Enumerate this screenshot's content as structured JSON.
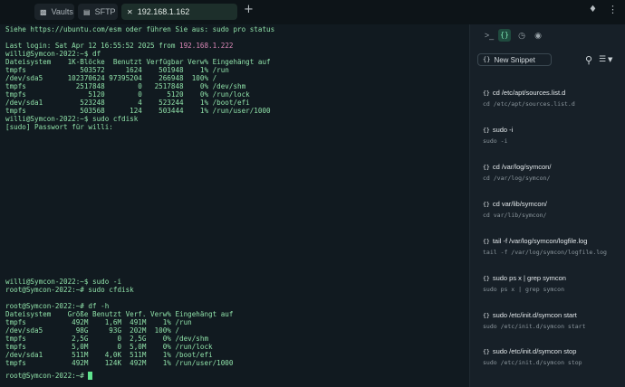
{
  "window": {
    "tabs": [
      {
        "label": "Vaults",
        "icon": "vault-icon"
      },
      {
        "label": "SFTP",
        "icon": "folder-icon"
      },
      {
        "label": "192.168.1.162",
        "icon": "close-icon",
        "active": true
      }
    ],
    "new_tab": "+"
  },
  "terminal": {
    "lines": [
      "Siehe https://ubuntu.com/esm oder führen Sie aus: sudo pro status",
      "",
      "Last login: Sat Apr 12 16:55:52 2025 from ",
      "willi@Symcon-2022:~$ df",
      "Dateisystem    1K-Blöcke  Benutzt Verfügbar Verw% Eingehängt auf",
      "tmpfs             503572     1624    501948    1% /run",
      "/dev/sda5      102370624 97395204    266948  100% /",
      "tmpfs            2517848        0   2517848    0% /dev/shm",
      "tmpfs               5120        0      5120    0% /run/lock",
      "/dev/sda1         523248        4    523244    1% /boot/efi",
      "tmpfs             503568      124    503444    1% /run/user/1000",
      "willi@Symcon-2022:~$ sudo cfdisk",
      "[sudo] Passwort für willi:",
      "willi@Symcon-2022:~$ sudo -i",
      "root@Symcon-2022:~# sudo cfdisk",
      "",
      "root@Symcon-2022:~# df -h",
      "Dateisystem    Größe Benutzt Verf. Verw% Eingehängt auf",
      "tmpfs           492M    1,6M  491M    1% /run",
      "/dev/sda5        98G     93G  202M  100% /",
      "tmpfs           2,5G       0  2,5G    0% /dev/shm",
      "tmpfs           5,0M       0  5,0M    0% /run/lock",
      "/dev/sda1       511M    4,0K  511M    1% /boot/efi",
      "tmpfs           492M    124K  492M    1% /run/user/1000",
      "root@Symcon-2022:~# "
    ],
    "highlight_ip": "192.168.1.222",
    "text_color": "#8fe0a8",
    "highlight_color": "#d987b6"
  },
  "panel": {
    "icons": [
      "terminal-icon",
      "snippets-icon",
      "history-icon",
      "palette-icon"
    ],
    "new_snippet_label": "New Snippet",
    "snippets": [
      {
        "name": "cd /etc/apt/sources.list.d",
        "command": "cd /etc/apt/sources.list.d"
      },
      {
        "name": "sudo -i",
        "command": "sudo -i"
      },
      {
        "name": "cd /var/log/symcon/",
        "command": "cd /var/log/symcon/"
      },
      {
        "name": "cd var/lib/symcon/",
        "command": "cd var/lib/symcon/"
      },
      {
        "name": "tail -f /var/log/symcon/logfile.log",
        "command": "tail -f /var/log/symcon/logfile.log"
      },
      {
        "name": "sudo ps x | grep symcon",
        "command": "sudo ps x | grep symcon"
      },
      {
        "name": "sudo /etc/init.d/symcon start",
        "command": "sudo /etc/init.d/symcon start"
      },
      {
        "name": "sudo /etc/init.d/symcon stop",
        "command": "sudo /etc/init.d/symcon stop"
      }
    ]
  }
}
